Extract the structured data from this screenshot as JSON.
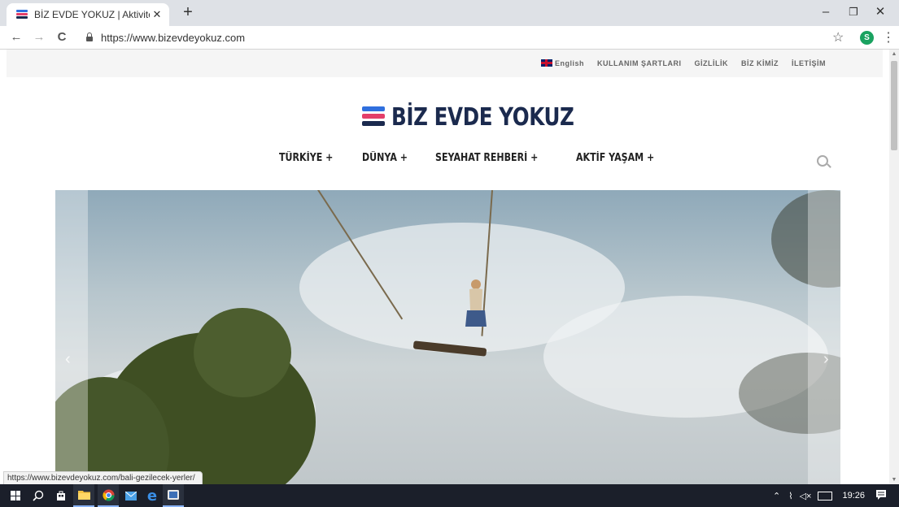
{
  "browser": {
    "tab_title": "BİZ EVDE YOKUZ | Aktivite, Mace",
    "tab_close": "✕",
    "new_tab": "+",
    "url": "https://www.bizevdeyokuz.com",
    "profile_initial": "S",
    "minimize": "–",
    "restore": "❐",
    "close": "✕",
    "back": "←",
    "forward": "→",
    "reload": "C",
    "star": "☆",
    "menu": "⋮"
  },
  "site": {
    "toplinks": {
      "english": "English",
      "terms": "KULLANIM ŞARTLARI",
      "privacy": "GİZLİLİK",
      "about": "BİZ KİMİZ",
      "contact": "İLETİŞİM"
    },
    "logo": "BİZ EVDE YOKUZ",
    "nav": [
      {
        "label": "TÜRKİYE +"
      },
      {
        "label": "DÜNYA +"
      },
      {
        "label": "SEYAHAT REHBERİ +"
      },
      {
        "label": "AKTİF YAŞAM +"
      }
    ]
  },
  "status_url": "https://www.bizevdeyokuz.com/bali-gezilecek-yerler/",
  "taskbar": {
    "time": "19:26"
  },
  "colors": {
    "logo_bar_blue": "#2f6fde",
    "logo_bar_pink": "#e33e6a",
    "logo_bar_navy": "#1b2a4e",
    "profile_green": "#1aa260"
  }
}
